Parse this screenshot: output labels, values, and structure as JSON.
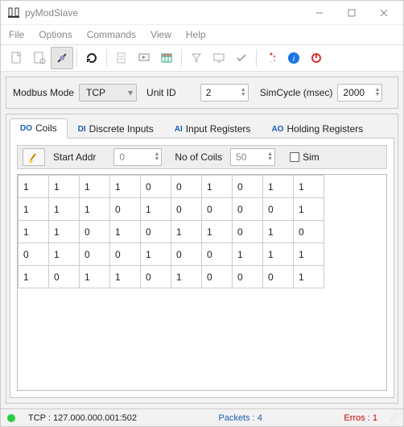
{
  "window": {
    "title": "pyModSlave",
    "menu": [
      "File",
      "Options",
      "Commands",
      "View",
      "Help"
    ]
  },
  "config": {
    "mode_label": "Modbus Mode",
    "mode_value": "TCP",
    "unitid_label": "Unit ID",
    "unitid_value": "2",
    "simcycle_label": "SimCycle (msec)",
    "simcycle_value": "2000"
  },
  "tabs": {
    "coils": {
      "prefix": "DO",
      "label": "Coils",
      "color": "#1a5fb4"
    },
    "discrete": {
      "prefix": "DI",
      "label": "Discrete Inputs",
      "color": "#1a5fb4"
    },
    "input": {
      "prefix": "AI",
      "label": "Input Registers",
      "color": "#1a5fb4"
    },
    "holding": {
      "prefix": "AO",
      "label": "Holding Registers",
      "color": "#1a5fb4"
    }
  },
  "coils": {
    "startaddr_label": "Start Addr",
    "startaddr_value": "0",
    "count_label": "No of Coils",
    "count_value": "50",
    "sim_label": "Sim",
    "data": [
      [
        1,
        1,
        1,
        1,
        0,
        0,
        1,
        0,
        1,
        1
      ],
      [
        1,
        1,
        1,
        0,
        1,
        0,
        0,
        0,
        0,
        1
      ],
      [
        1,
        1,
        0,
        1,
        0,
        1,
        1,
        0,
        1,
        0
      ],
      [
        0,
        1,
        0,
        0,
        1,
        0,
        0,
        1,
        1,
        1
      ],
      [
        1,
        0,
        1,
        1,
        0,
        1,
        0,
        0,
        0,
        1
      ]
    ]
  },
  "status": {
    "conn": "TCP : 127.000.000.001:502",
    "packets": "Packets : 4",
    "errors": "Erros : 1"
  }
}
